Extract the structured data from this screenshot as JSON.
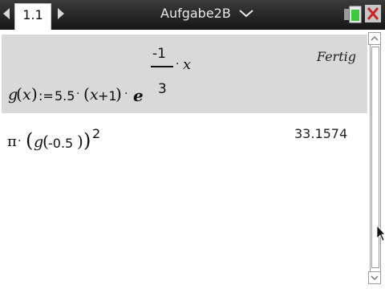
{
  "titlebar": {
    "tab_label": "1.1",
    "document_title": "Aufgabe2B",
    "icons": {
      "prev": "chevron-left-icon",
      "next": "chevron-right-icon",
      "menu": "chevron-down-icon",
      "battery": "battery-icon",
      "close": "close-icon"
    },
    "colors": {
      "bar": "#1e1e1e",
      "battery": "#3cc83c",
      "close": "#c82828"
    }
  },
  "history": [
    {
      "input": {
        "func": "g",
        "var": "x",
        "define": ":=",
        "coef": "5.5",
        "dot": "·",
        "paren_open": "(",
        "paren_close": ")",
        "plus_one": "+1",
        "base": "e",
        "exp_num": "-1",
        "exp_den": "3",
        "exp_var": "x"
      },
      "output": "Fertig"
    },
    {
      "input": {
        "pi": "π",
        "dot": "·",
        "func": "g",
        "arg": "-0.5",
        "power": "2"
      },
      "output": "33.1574"
    }
  ],
  "colors": {
    "highlight_row": "#d9d9d9"
  }
}
